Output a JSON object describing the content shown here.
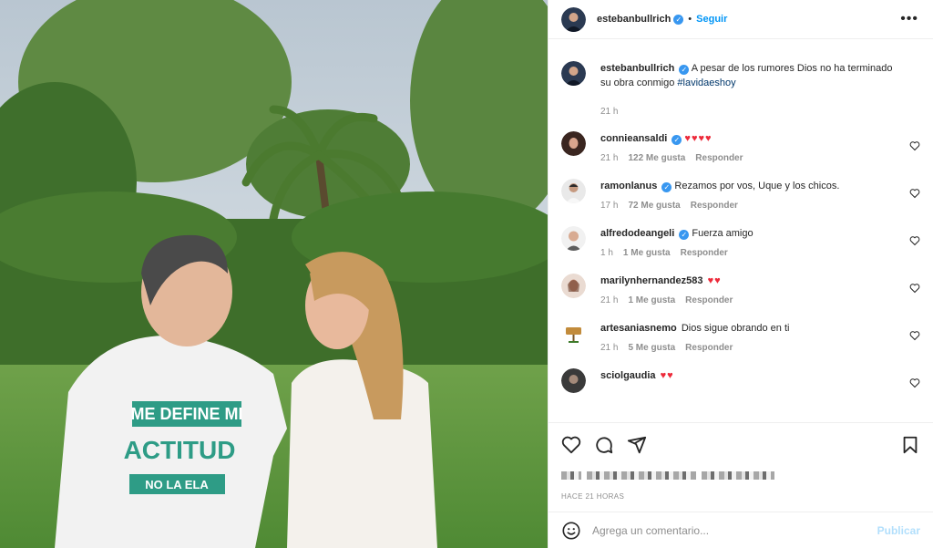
{
  "post": {
    "author": "estebanbullrich",
    "follow_label": "Seguir",
    "separator": "•",
    "more_label": "•••",
    "caption_text": "A pesar de los rumores Dios no ha terminado su obra conmigo",
    "caption_hashtag": "#lavidaeshoy",
    "caption_time": "21 h",
    "time_ago": "HACE 21 HORAS",
    "photo_shirt_lines": [
      "ME DEFINE MI",
      "ACTITUD",
      "NO LA ELA"
    ]
  },
  "comments": [
    {
      "user": "connieansaldi",
      "verified": true,
      "text": "",
      "hearts": "♥♥♥♥",
      "time": "21 h",
      "likes": "122 Me gusta",
      "reply": "Responder",
      "avatar": "avatar-woman-dark"
    },
    {
      "user": "ramonlanus",
      "verified": true,
      "text": "Rezamos por vos, Uque y los chicos.",
      "hearts": "",
      "time": "17 h",
      "likes": "72 Me gusta",
      "reply": "Responder",
      "avatar": "avatar-man"
    },
    {
      "user": "alfredodeangeli",
      "verified": true,
      "text": "Fuerza amigo",
      "hearts": "",
      "time": "1 h",
      "likes": "1 Me gusta",
      "reply": "Responder",
      "avatar": "avatar-man-light"
    },
    {
      "user": "marilynhernandez583",
      "verified": false,
      "text": "",
      "hearts": "♥♥",
      "time": "21 h",
      "likes": "1 Me gusta",
      "reply": "Responder",
      "avatar": "avatar-woman"
    },
    {
      "user": "artesaniasnemo",
      "verified": false,
      "text": "Dios sigue obrando en ti",
      "hearts": "",
      "time": "21 h",
      "likes": "5 Me gusta",
      "reply": "Responder",
      "avatar": "avatar-sign"
    },
    {
      "user": "sciolgaudia",
      "verified": false,
      "text": "",
      "hearts": "♥♥",
      "time": "",
      "likes": "",
      "reply": "",
      "avatar": "avatar-partial"
    }
  ],
  "add_comment": {
    "placeholder": "Agrega un comentario...",
    "publish_label": "Publicar"
  },
  "icons": [
    "heart-icon",
    "comment-icon",
    "share-icon",
    "bookmark-icon",
    "emoji-icon",
    "more-icon",
    "verified-icon"
  ],
  "colors": {
    "link_blue": "#0095f6",
    "heart_red": "#ed2a3a",
    "muted": "#8e8e8e",
    "hashtag": "#00376b",
    "shirt_green": "#2e9c86"
  }
}
